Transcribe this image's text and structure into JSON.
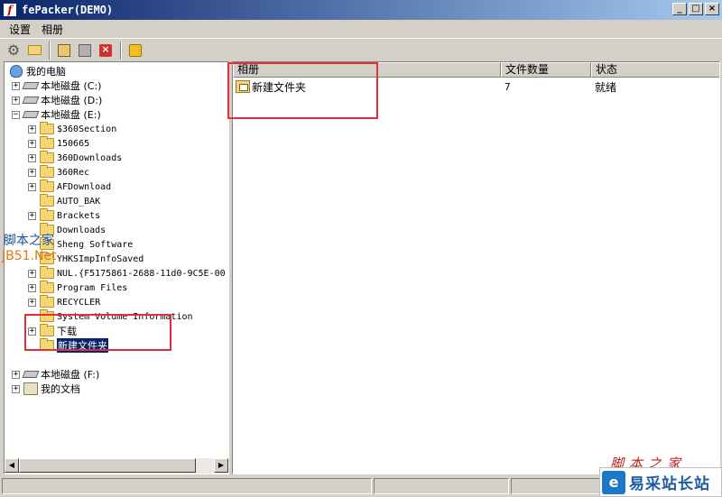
{
  "window": {
    "title": "fePacker(DEMO)",
    "icon_letter": "f",
    "buttons": [
      "_",
      "□",
      "×"
    ]
  },
  "menu": [
    "设置",
    "相册"
  ],
  "toolbar": {
    "icons": [
      "gear-icon",
      "folder-open-icon",
      "pack-icon",
      "disabled-icon",
      "delete-icon",
      "info-icon"
    ],
    "delete_glyph": "×"
  },
  "tree": {
    "root": "我的电脑",
    "drive_c": "本地磁盘 (C:)",
    "drive_d": "本地磁盘 (D:)",
    "drive_e": "本地磁盘 (E:)",
    "drive_e_folders": [
      {
        "label": "$360Section",
        "expandable": true
      },
      {
        "label": "150665",
        "expandable": true
      },
      {
        "label": "360Downloads",
        "expandable": true
      },
      {
        "label": "360Rec",
        "expandable": true
      },
      {
        "label": "AFDownload",
        "expandable": true
      },
      {
        "label": "AUTO_BAK",
        "expandable": false
      },
      {
        "label": "Brackets",
        "expandable": true
      },
      {
        "label": "Downloads",
        "expandable": false
      },
      {
        "label": "Sheng Software",
        "expandable": false
      },
      {
        "label": "YHKSImpInfoSaved",
        "expandable": false
      },
      {
        "label": "NUL.{F5175861-2688-11d0-9C5E-00",
        "expandable": true
      },
      {
        "label": "Program Files",
        "expandable": true
      },
      {
        "label": "RECYCLER",
        "expandable": true
      },
      {
        "label": "System Volume Information",
        "expandable": false
      },
      {
        "label": "下载",
        "expandable": true
      },
      {
        "label": "新建文件夹",
        "expandable": false,
        "selected": true
      }
    ],
    "drive_f": "本地磁盘 (F:)",
    "my_docs": "我的文档",
    "plus": "+",
    "minus": "−"
  },
  "list": {
    "columns": [
      "相册",
      "文件数量",
      "状态"
    ],
    "rows": [
      {
        "name": "新建文件夹",
        "count": "7",
        "status": "就绪"
      }
    ]
  },
  "scroll": {
    "left": "◀",
    "right": "▶"
  },
  "watermarks": {
    "left_top": "脚本之家",
    "left_bottom": "JB51.Net",
    "badge_logo": "e",
    "badge_text": "易采站长站",
    "red_text": "脚本之家"
  },
  "colors": {
    "title_gradient_start": "#0a246a",
    "selection": "#0a246a",
    "annotation_red": "#e0303a"
  }
}
